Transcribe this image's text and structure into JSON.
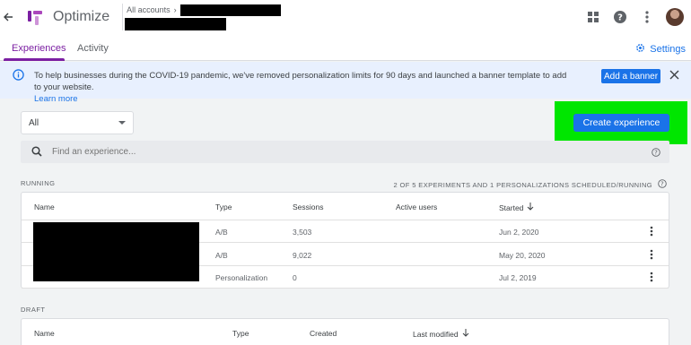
{
  "app": {
    "product_name": "Optimize",
    "breadcrumb": "All accounts",
    "accent": "#7b1fa2",
    "primary": "#1a73e8"
  },
  "tabs": [
    {
      "label": "Experiences",
      "active": true
    },
    {
      "label": "Activity",
      "active": false
    }
  ],
  "settings_label": "Settings",
  "banner": {
    "text": "To help businesses during the COVID-19 pandemic, we've removed personalization limits for 90 days and launched a banner template to add to your website.",
    "link": "Learn more",
    "button": "Add a banner"
  },
  "filter": {
    "selected": "All"
  },
  "create_button": "Create experience",
  "search": {
    "placeholder": "Find an experience..."
  },
  "running": {
    "label": "RUNNING",
    "meta": "2 OF 5 EXPERIMENTS AND 1 PERSONALIZATIONS SCHEDULED/RUNNING",
    "columns": [
      "Name",
      "Type",
      "Sessions",
      "Active users",
      "Started"
    ],
    "rows": [
      {
        "type": "A/B",
        "sessions": "3,503",
        "active_users": "",
        "started": "Jun 2, 2020"
      },
      {
        "type": "A/B",
        "sessions": "9,022",
        "active_users": "",
        "started": "May 20, 2020"
      },
      {
        "type": "Personalization",
        "sessions": "0",
        "active_users": "",
        "started": "Jul 2, 2019"
      }
    ]
  },
  "draft": {
    "label": "DRAFT",
    "columns": [
      "Name",
      "Type",
      "Created",
      "Last modified"
    ]
  }
}
